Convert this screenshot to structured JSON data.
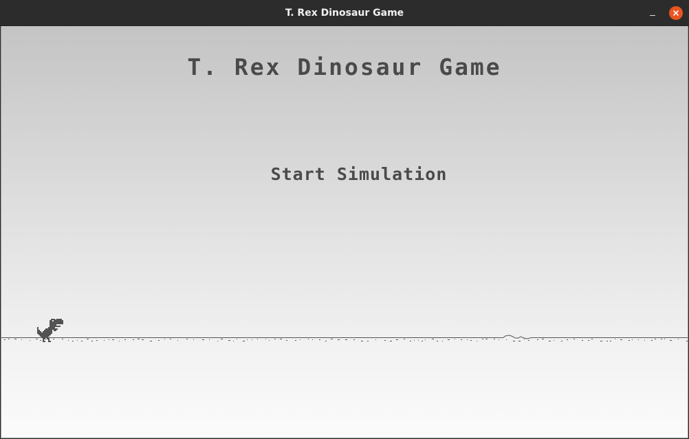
{
  "window": {
    "title": "T. Rex Dinosaur Game",
    "controls": {
      "minimize_icon": "minimize-icon",
      "close_icon": "close-icon"
    },
    "close_color": "#e95420"
  },
  "game": {
    "title": "T. Rex Dinosaur Game",
    "start_label": "Start Simulation",
    "player": "t-rex-dinosaur-icon",
    "ink_color": "#535353"
  }
}
